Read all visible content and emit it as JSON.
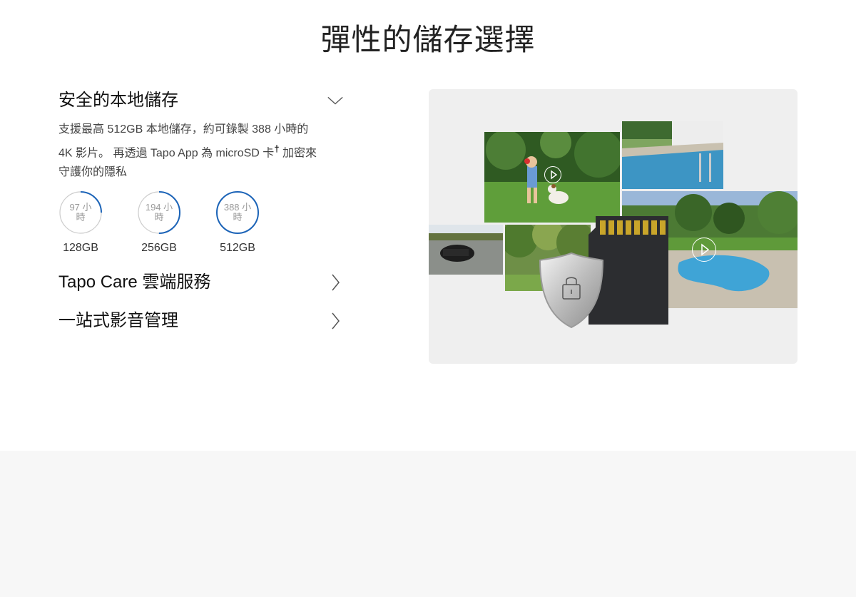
{
  "page": {
    "title": "彈性的儲存選擇"
  },
  "accordion": [
    {
      "title": "安全的本地儲存",
      "expanded": true,
      "body_line1": "支援最高 512GB 本地儲存，約可錄製 388 小時的",
      "body_line2a": "4K 影片。 再透過 Tapo App 為 microSD 卡",
      "body_sup": "†",
      "body_line2b": " 加密來",
      "body_line3": "守護你的隱私",
      "capacities": [
        {
          "hours": "97 小時",
          "size": "128GB",
          "progress": 0.25
        },
        {
          "hours": "194 小時",
          "size": "256GB",
          "progress": 0.5
        },
        {
          "hours": "388 小時",
          "size": "512GB",
          "progress": 1.0
        }
      ]
    },
    {
      "title": "Tapo Care 雲端服務",
      "expanded": false
    },
    {
      "title": "一站式影音管理",
      "expanded": false
    }
  ],
  "colors": {
    "accent": "#1b63b7",
    "ring_track": "#cccccc",
    "panel_bg": "#efefef",
    "footer_bg": "#f7f7f7"
  },
  "icons": {
    "expanded": "chevron-down-icon",
    "collapsed": "chevron-right-icon",
    "play": "play-icon",
    "lock": "lock-icon"
  }
}
